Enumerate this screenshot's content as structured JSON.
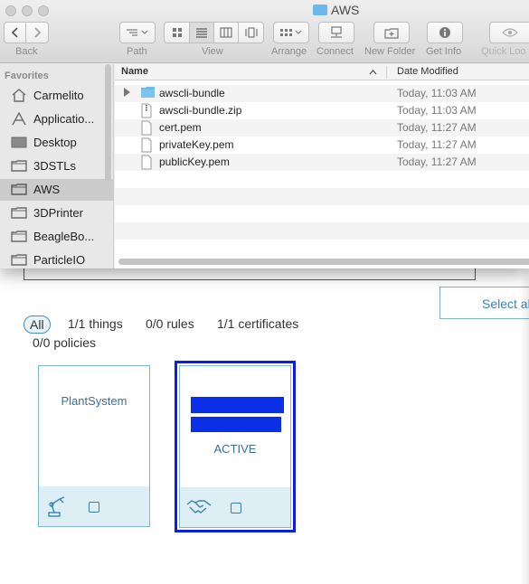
{
  "finder": {
    "window_title": "AWS",
    "toolbar": {
      "back_label": "Back",
      "path_label": "Path",
      "view_label": "View",
      "arrange_label": "Arrange",
      "connect_label": "Connect",
      "new_folder_label": "New Folder",
      "get_info_label": "Get Info",
      "quick_look_label": "Quick Loo"
    },
    "sidebar": {
      "heading": "Favorites",
      "items": [
        {
          "label": "Carmelito",
          "icon": "home-icon"
        },
        {
          "label": "Applicatio...",
          "icon": "applications-icon"
        },
        {
          "label": "Desktop",
          "icon": "desktop-icon"
        },
        {
          "label": "3DSTLs",
          "icon": "folder-icon"
        },
        {
          "label": "AWS",
          "icon": "folder-icon",
          "selected": true
        },
        {
          "label": "3DPrinter",
          "icon": "folder-icon"
        },
        {
          "label": "BeagleBo...",
          "icon": "folder-icon"
        },
        {
          "label": "ParticleIO",
          "icon": "folder-icon"
        }
      ]
    },
    "columns": {
      "name": "Name",
      "date_modified": "Date Modified"
    },
    "files": [
      {
        "name": "awscli-bundle",
        "date": "Today, 11:03 AM",
        "kind": "folder"
      },
      {
        "name": "awscli-bundle.zip",
        "date": "Today, 11:03 AM",
        "kind": "zip"
      },
      {
        "name": "cert.pem",
        "date": "Today, 11:27 AM",
        "kind": "file"
      },
      {
        "name": "privateKey.pem",
        "date": "Today, 11:27 AM",
        "kind": "file"
      },
      {
        "name": "publicKey.pem",
        "date": "Today, 11:27 AM",
        "kind": "file"
      }
    ]
  },
  "page": {
    "select_all_label": "Select al",
    "filters": {
      "all": "All",
      "things": "1/1 things",
      "rules": "0/0 rules",
      "certificates": "1/1 certificates",
      "policies": "0/0 policies"
    },
    "cards": [
      {
        "title": "PlantSystem",
        "icon": "robot-arm-icon"
      },
      {
        "title": "ACTIVE",
        "icon": "handshake-icon",
        "selected": true
      }
    ]
  },
  "colors": {
    "accent": "#3b83b9",
    "selection_outline": "#0a1ee6",
    "card_footer": "#ddeff5",
    "folder_blue": "#6bb8ea"
  }
}
